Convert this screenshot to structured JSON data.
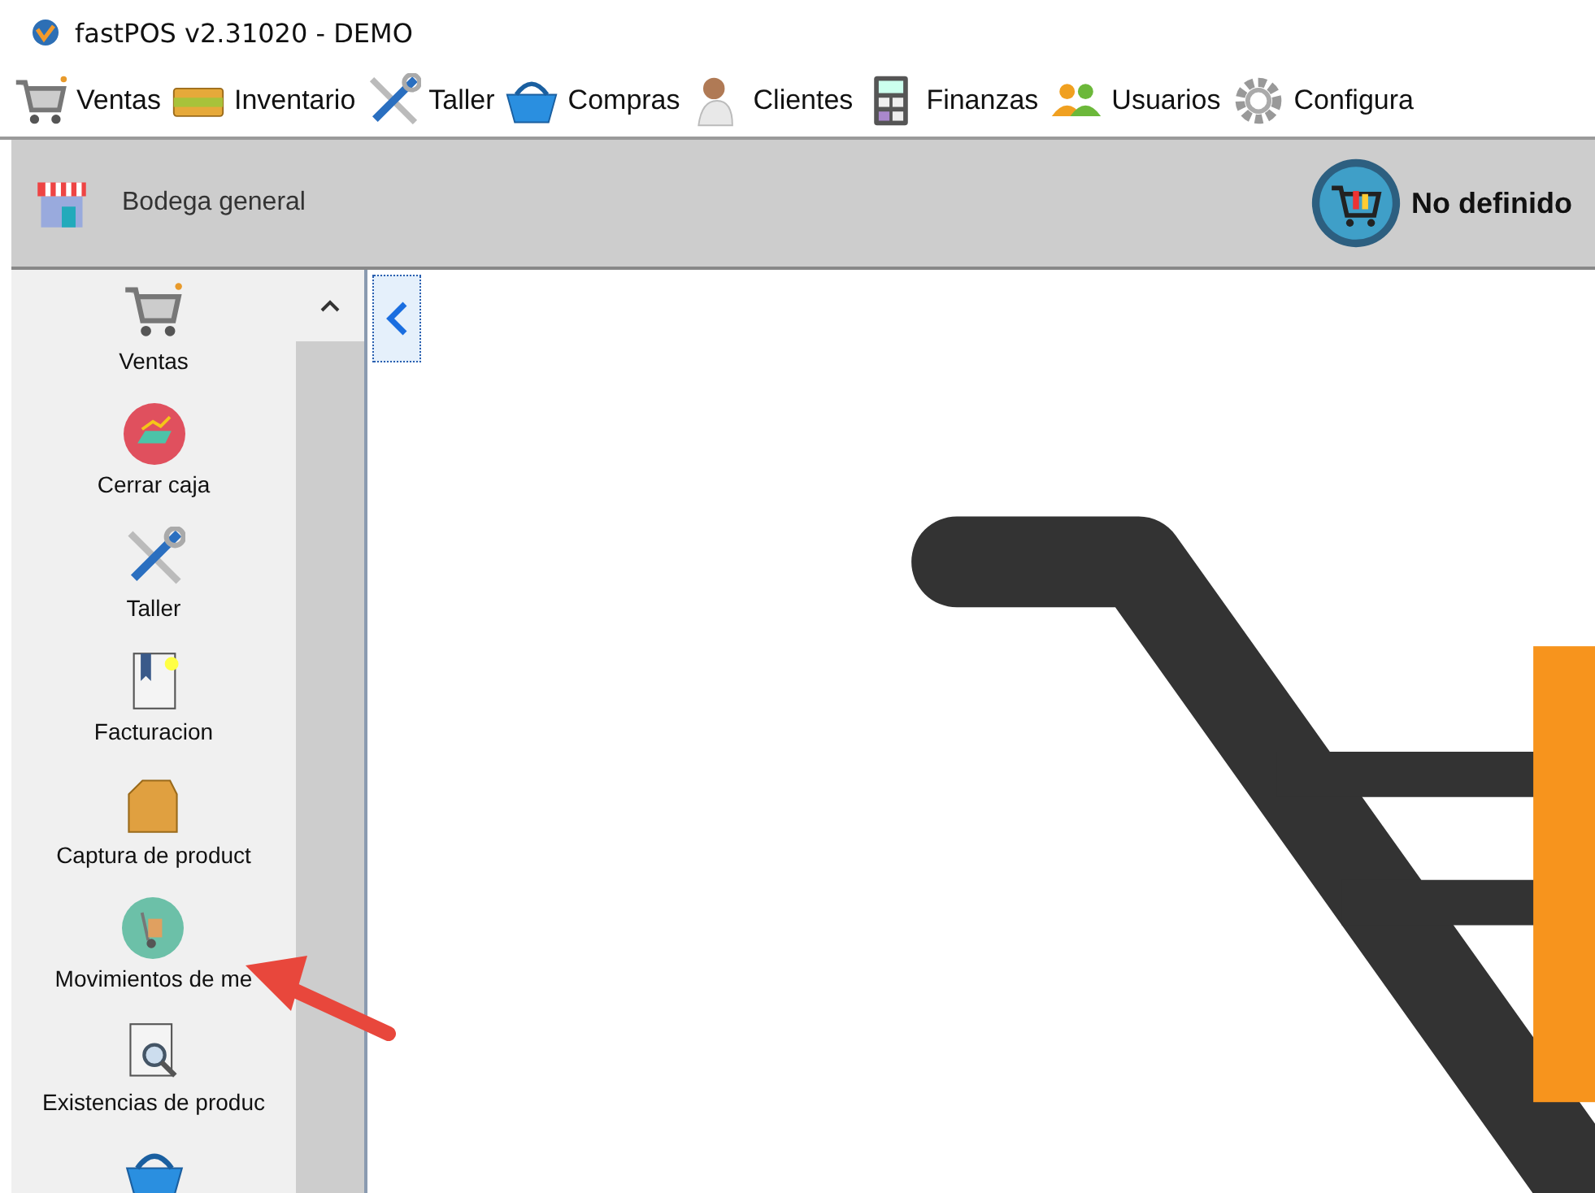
{
  "window": {
    "title": "fastPOS v2.31020 - DEMO"
  },
  "menu": [
    {
      "label": "Ventas",
      "kind": "cart"
    },
    {
      "label": "Inventario",
      "kind": "box"
    },
    {
      "label": "Taller",
      "kind": "tools"
    },
    {
      "label": "Compras",
      "kind": "basket"
    },
    {
      "label": "Clientes",
      "kind": "person"
    },
    {
      "label": "Finanzas",
      "kind": "calculator"
    },
    {
      "label": "Usuarios",
      "kind": "users"
    },
    {
      "label": "Configura",
      "kind": "gear"
    }
  ],
  "header": {
    "store": "Bodega general",
    "user": "No definido"
  },
  "sidebar": {
    "items": [
      {
        "label": "Ventas",
        "kind": "cart"
      },
      {
        "label": "Cerrar caja",
        "kind": "cash"
      },
      {
        "label": "Taller",
        "kind": "tools"
      },
      {
        "label": "Facturacion",
        "kind": "document"
      },
      {
        "label": "Captura de product",
        "kind": "box"
      },
      {
        "label": "Movimientos de me",
        "kind": "dolly"
      },
      {
        "label": "Existencias de produc",
        "kind": "search-doc"
      },
      {
        "kind": "basket"
      }
    ]
  }
}
